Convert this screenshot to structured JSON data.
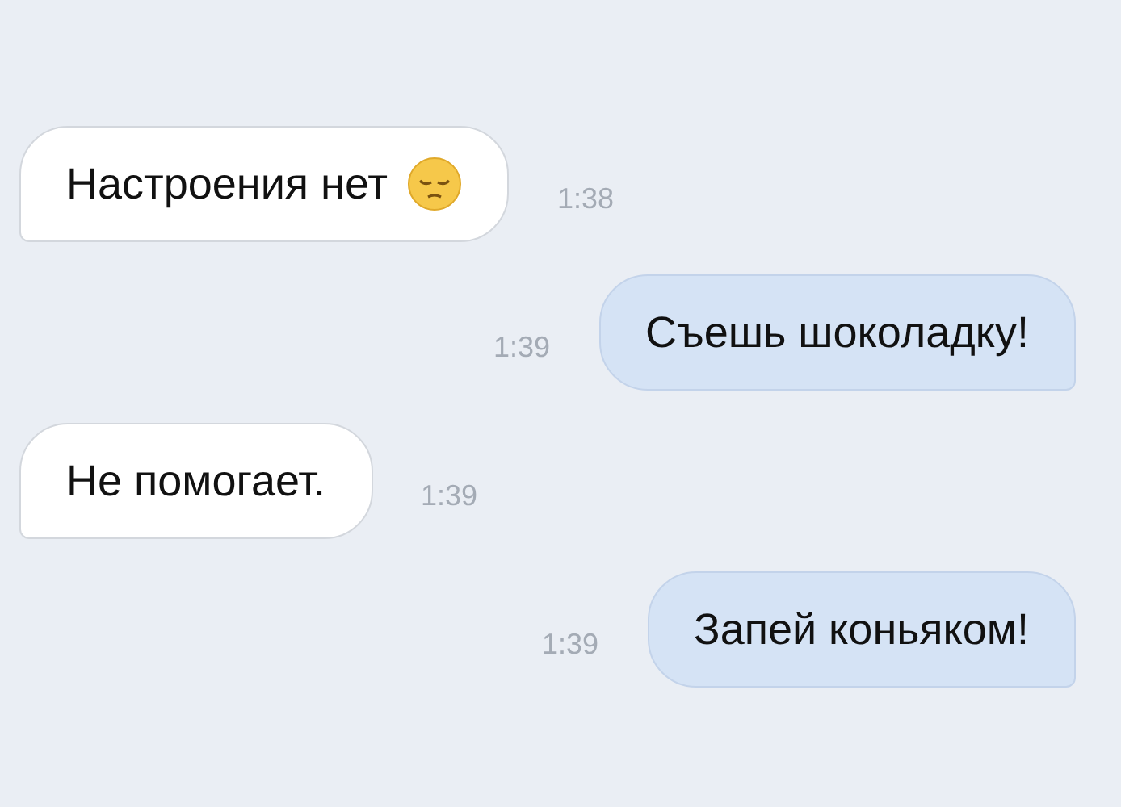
{
  "messages": [
    {
      "kind": "incoming",
      "text": "Настроения нет",
      "emoji": {
        "kind": "pensive"
      },
      "time": "1:38"
    },
    {
      "kind": "outgoing",
      "text": "Съешь шоколадку!",
      "time": "1:39"
    },
    {
      "kind": "incoming",
      "text": "Не помогает.",
      "time": "1:39"
    },
    {
      "kind": "outgoing",
      "text": "Запей коньяком!",
      "time": "1:39"
    }
  ]
}
